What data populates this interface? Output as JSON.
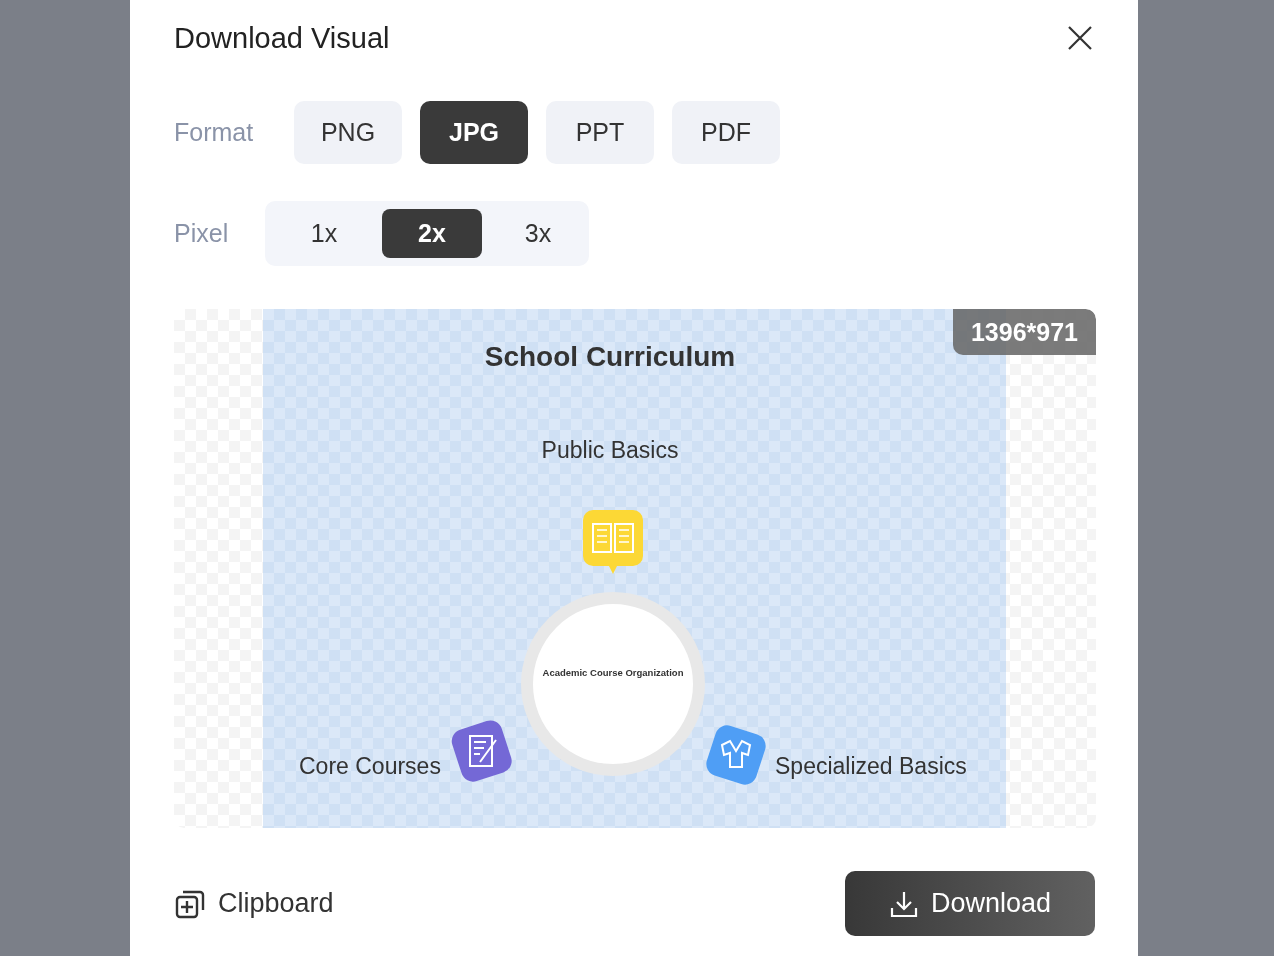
{
  "dialog": {
    "title": "Download Visual"
  },
  "format": {
    "label": "Format",
    "options": [
      {
        "label": "PNG",
        "selected": false
      },
      {
        "label": "JPG",
        "selected": true
      },
      {
        "label": "PPT",
        "selected": false
      },
      {
        "label": "PDF",
        "selected": false
      }
    ]
  },
  "pixel": {
    "label": "Pixel",
    "options": [
      {
        "label": "1x",
        "selected": false
      },
      {
        "label": "2x",
        "selected": true
      },
      {
        "label": "3x",
        "selected": false
      }
    ]
  },
  "preview": {
    "size_badge": "1396*971",
    "slide": {
      "title": "School Curriculum",
      "center": "Academic Course Organization",
      "branches": [
        {
          "label": "Public Basics",
          "kind": "top",
          "color": "#fcd835"
        },
        {
          "label": "Core Courses",
          "kind": "left",
          "color": "#7468d6"
        },
        {
          "label": "Specialized Basics",
          "kind": "right",
          "color": "#4f9ef5"
        }
      ]
    }
  },
  "actions": {
    "clipboard": "Clipboard",
    "download": "Download"
  }
}
